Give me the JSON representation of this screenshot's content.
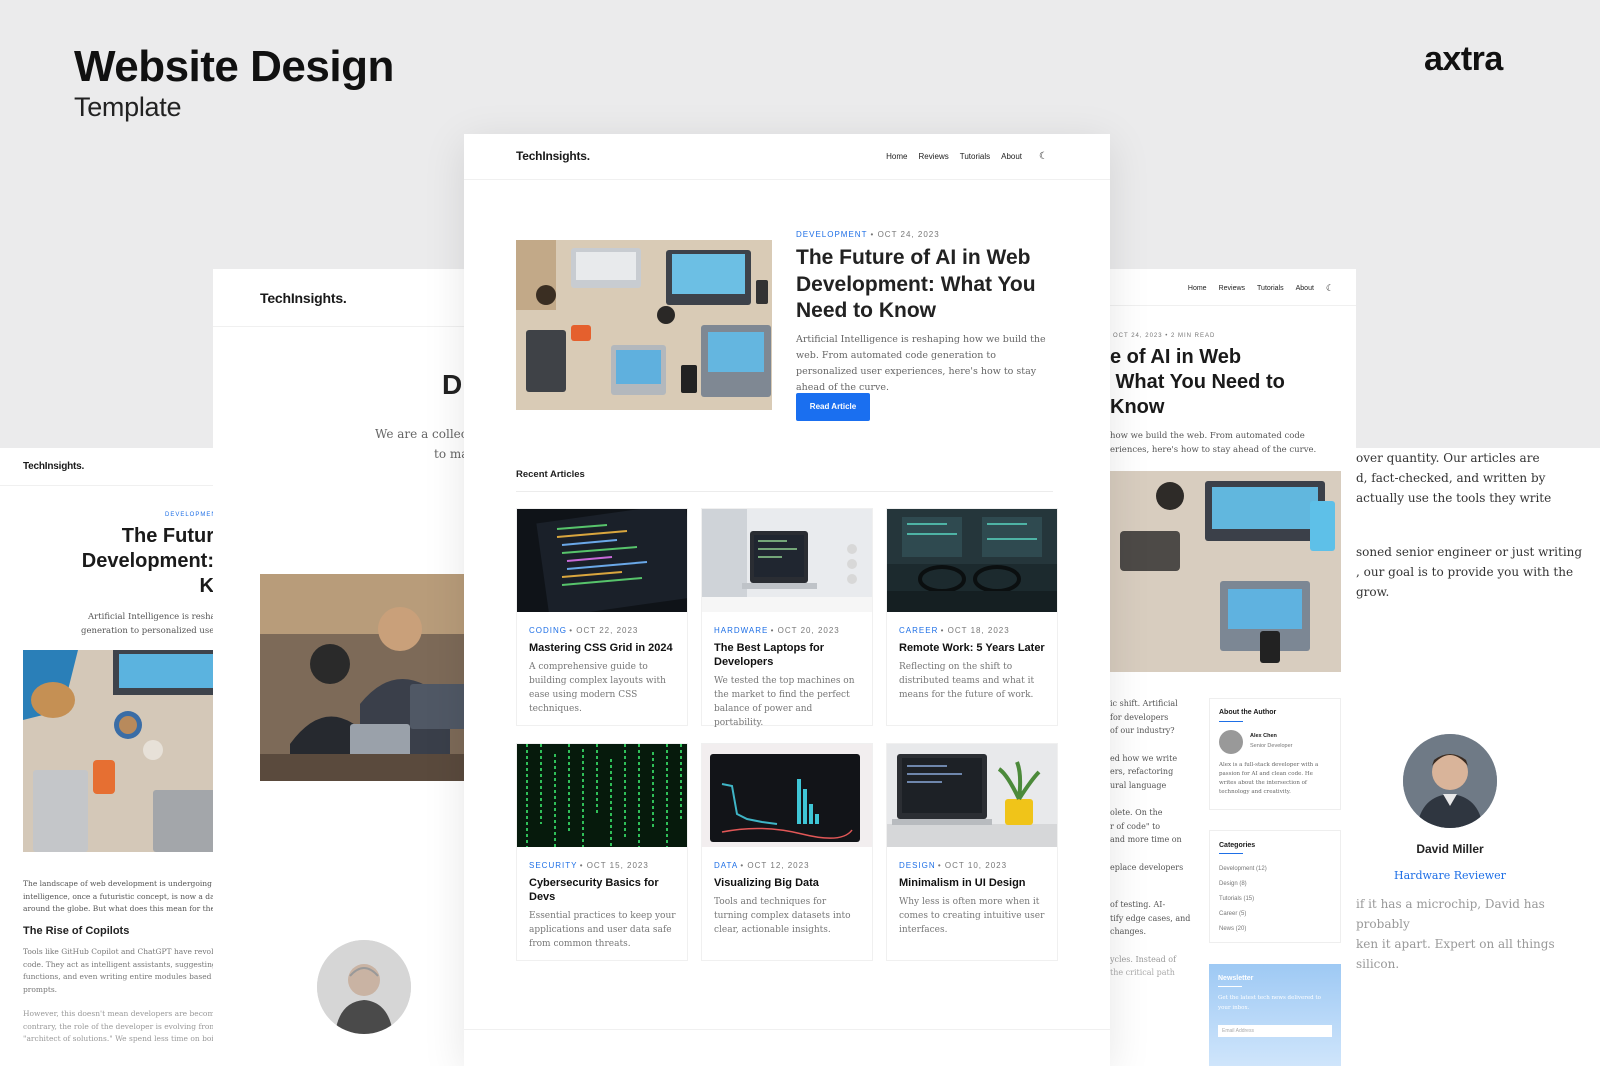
{
  "cover": {
    "title": "Website Design",
    "subtitle": "Template",
    "brand": "axtra"
  },
  "site": {
    "logo": "TechInsights."
  },
  "nav": {
    "home": "Home",
    "reviews": "Reviews",
    "tutorials": "Tutorials",
    "about": "About",
    "theme_icon": "moon-icon"
  },
  "hero": {
    "category": "DEVELOPMENT",
    "date": "• OCT 24, 2023",
    "title": "The Future of AI in Web Development: What You Need to Know",
    "excerpt": "Artificial Intelligence is reshaping how we build the web. From automated code generation to personalized user experiences, here's how to stay ahead of the curve.",
    "button": "Read Article"
  },
  "recent": {
    "heading": "Recent Articles",
    "articles": [
      {
        "category": "CODING",
        "date": "• OCT 22, 2023",
        "title": "Mastering CSS Grid in 2024",
        "excerpt": "A comprehensive guide to building complex layouts with ease using modern CSS techniques."
      },
      {
        "category": "HARDWARE",
        "date": "• OCT 20, 2023",
        "title": "The Best Laptops for Developers",
        "excerpt": "We tested the top machines on the market to find the perfect balance of power and portability."
      },
      {
        "category": "CAREER",
        "date": "• OCT 18, 2023",
        "title": "Remote Work: 5 Years Later",
        "excerpt": "Reflecting on the shift to distributed teams and what it means for the future of work."
      },
      {
        "category": "SECURITY",
        "date": "• OCT 15, 2023",
        "title": "Cybersecurity Basics for Devs",
        "excerpt": "Essential practices to keep your applications and user data safe from common threats."
      },
      {
        "category": "DATA",
        "date": "• OCT 12, 2023",
        "title": "Visualizing Big Data",
        "excerpt": "Tools and techniques for turning complex datasets into clear, actionable insights."
      },
      {
        "category": "DESIGN",
        "date": "• OCT 10, 2023",
        "title": "Minimalism in UI Design",
        "excerpt": "Why less is often more when it comes to creating intuitive user interfaces."
      }
    ]
  },
  "left_page": {
    "category": "DEVELOPMENT",
    "title_l1": "The Futur",
    "title_l2": "Development:",
    "title_l3": "K",
    "excerpt_l1": "Artificial Intelligence is reshaping",
    "excerpt_l2": "generation to personalized user exp",
    "body1_l1": "The landscape of web development is undergoing a seism",
    "body1_l2": "intelligence, once a futuristic concept, is now a daily tool",
    "body1_l3": "around the globe. But what does this mean for the future",
    "subhead": "The Rise of Copilots",
    "body2_l1": "Tools like GitHub Copilot and ChatGPT have revolutioni",
    "body2_l2": "code. They act as intelligent assistants, suggesting snipp",
    "body2_l3": "functions, and even writing entire modules based on nat",
    "body2_l4": "prompts.",
    "body3_l1": "However, this doesn't mean developers are becoming ob",
    "body3_l2": "contrary, the role of the developer is evolving from \"writ",
    "body3_l3": "\"architect of solutions.\" We spend less time on boilerplat"
  },
  "about_page": {
    "heading_letter": "D",
    "line1": "We are a collect",
    "line2": "to ma"
  },
  "right_page": {
    "meta": "OCT 24, 2023 • 2 MIN READ",
    "title_l1": "e of AI in Web",
    "title_l2": " What You Need to",
    "title_l3": "Know",
    "excerpt_l1": "how we build the web. From automated code",
    "excerpt_l2": "eriences, here's how to stay ahead of the curve.",
    "body_frag": [
      "ic shift. Artificial",
      "for developers",
      "of our industry?",
      "ed how we write",
      "ers, refactoring",
      "ural language",
      "olete. On the",
      "r of code\" to",
      "and more time on",
      "eplace developers",
      "of testing. AI-",
      "tify edge cases, and",
      "changes.",
      "ycles. Instead of",
      "the critical path"
    ],
    "author_box": {
      "heading": "About the Author",
      "name": "Alex Chen",
      "role": "Senior Developer",
      "bio": "Alex is a full-stack developer with a passion for AI and clean code. He writes about the intersection of technology and creativity."
    },
    "categories_box": {
      "heading": "Categories",
      "items": [
        "Development (12)",
        "Design (8)",
        "Tutorials (15)",
        "Career (5)",
        "News (20)"
      ]
    },
    "newsletter": {
      "heading": "Newsletter",
      "text": "Get the latest tech news delivered to your inbox.",
      "placeholder": "Email Address"
    }
  },
  "far_right_page": {
    "p1": [
      "over quantity. Our articles are",
      "d, fact-checked, and written by",
      "actually use the tools they write"
    ],
    "p2": [
      "soned senior engineer or just writing",
      ", our goal is to provide you with the",
      "grow."
    ],
    "author_name": "David Miller",
    "author_role": "Hardware Reviewer",
    "bio": [
      "if it has a microchip, David has probably",
      "ken it apart. Expert on all things silicon."
    ]
  }
}
